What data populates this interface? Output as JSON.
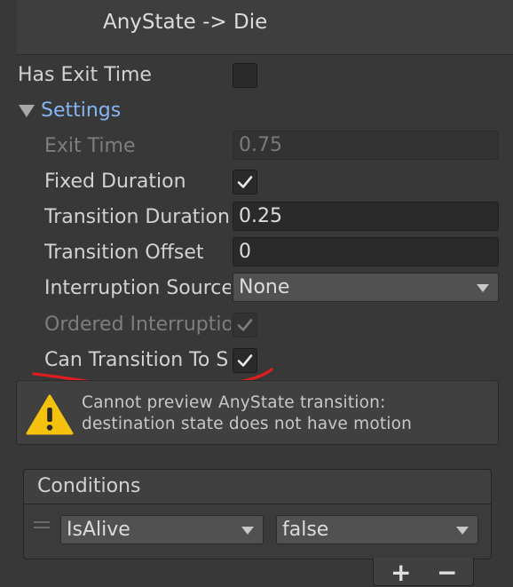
{
  "header": {
    "title": "AnyState -> Die"
  },
  "has_exit_time": {
    "label": "Has Exit Time",
    "checked": false
  },
  "settings": {
    "label": "Settings",
    "exit_time": {
      "label": "Exit Time",
      "value": "0.75"
    },
    "fixed_duration": {
      "label": "Fixed Duration",
      "checked": true
    },
    "transition_duration": {
      "label": "Transition Duration",
      "value": "0.25"
    },
    "transition_offset": {
      "label": "Transition Offset",
      "value": "0"
    },
    "interruption_source": {
      "label": "Interruption Source",
      "value": "None"
    },
    "ordered_interruption": {
      "label": "Ordered Interruption",
      "checked": true
    },
    "can_transition_to_self": {
      "label": "Can Transition To Self",
      "checked": true
    }
  },
  "warning": {
    "line1": "Cannot preview AnyState transition:",
    "line2": "destination state does not have motion"
  },
  "conditions": {
    "title": "Conditions",
    "rows": [
      {
        "parameter": "IsAlive",
        "value": "false"
      }
    ],
    "add_label": "+",
    "remove_label": "−"
  },
  "colors": {
    "background": "#383838",
    "accent_link": "#85b5f3",
    "warning_icon": "#f4c20d",
    "annotation": "#e01e1e"
  }
}
